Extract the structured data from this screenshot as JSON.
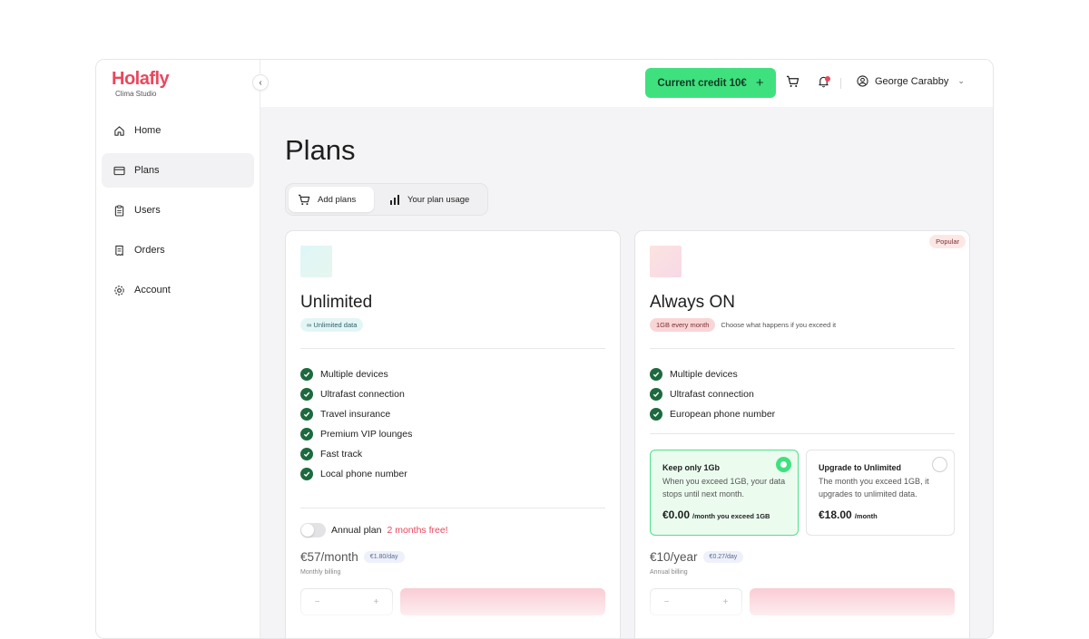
{
  "brand": {
    "name": "Holafly",
    "subtitle": "Clima Studio"
  },
  "sidebar": {
    "items": [
      {
        "label": "Home",
        "icon": "home-icon",
        "active": false
      },
      {
        "label": "Plans",
        "icon": "card-icon",
        "active": true
      },
      {
        "label": "Users",
        "icon": "clipboard-icon",
        "active": false
      },
      {
        "label": "Orders",
        "icon": "receipt-icon",
        "active": false
      },
      {
        "label": "Account",
        "icon": "gear-icon",
        "active": false
      }
    ]
  },
  "topbar": {
    "credit_label": "Current credit 10€",
    "credit_plus": "+",
    "user_name": "George Carabby"
  },
  "page": {
    "title": "Plans",
    "tabs": [
      {
        "label": "Add plans",
        "icon": "cart-icon",
        "active": true
      },
      {
        "label": "Your plan usage",
        "icon": "bar-chart-icon",
        "active": false
      }
    ]
  },
  "plans": {
    "unlimited": {
      "title": "Unlimited",
      "chip": "∞ Unlimited data",
      "features": [
        "Multiple devices",
        "Ultrafast connection",
        "Travel insurance",
        "Premium VIP lounges",
        "Fast track",
        "Local phone number"
      ],
      "annual_label": "Annual plan",
      "annual_promo": "2 months free!",
      "price": "€57/month",
      "per_day": "€1.80/day",
      "billing": "Monthly billing",
      "colors": {
        "thumb_from": "#dff5f8",
        "thumb_to": "#e6f7ee",
        "chip_bg": "#e3f6f6",
        "chip_fg": "#2f5f66"
      }
    },
    "always_on": {
      "badge": "Popular",
      "title": "Always ON",
      "chip": "1GB every month",
      "chip_note": "Choose what happens if you exceed it",
      "features": [
        "Multiple devices",
        "Ultrafast connection",
        "European phone number"
      ],
      "options": [
        {
          "title": "Keep only 1Gb",
          "desc": "When you exceed 1GB, your data stops until next month.",
          "price": "€0.00",
          "price_suffix": "/month you exceed 1GB",
          "selected": true
        },
        {
          "title": "Upgrade to Unlimited",
          "desc": "The month you exceed 1GB, it upgrades to unlimited data.",
          "price": "€18.00",
          "price_suffix": "/month",
          "selected": false
        }
      ],
      "price": "€10/year",
      "per_day": "€0.27/day",
      "billing": "Annual billing",
      "colors": {
        "thumb_from": "#fde3e1",
        "thumb_to": "#f6d9e6",
        "chip_bg": "#f9d6d6",
        "chip_fg": "#7a2d35"
      }
    }
  },
  "colors": {
    "accent_green": "#3fe17f",
    "brand_red": "#e8485d",
    "check_green": "#1d6a3f"
  }
}
